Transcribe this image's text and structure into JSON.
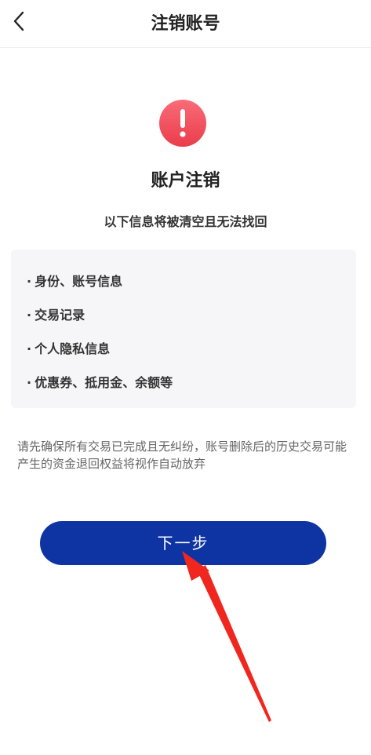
{
  "header": {
    "title": "注销账号"
  },
  "main": {
    "heading": "账户注销",
    "subheading": "以下信息将被清空且无法找回",
    "items": [
      "身份、账号信息",
      "交易记录",
      "个人隐私信息",
      "优惠券、抵用金、余额等"
    ],
    "bullet": "·",
    "notice": "请先确保所有交易已完成且无纠纷，账号删除后的历史交易可能产生的资金退回权益将视作自动放弃",
    "next_label": "下一步"
  },
  "colors": {
    "primary_button": "#0e33a2",
    "warning": "#f04c5a",
    "annotation_arrow": "#f0271f"
  },
  "icons": {
    "back": "chevron-left-icon",
    "warning": "exclamation-circle-icon"
  }
}
